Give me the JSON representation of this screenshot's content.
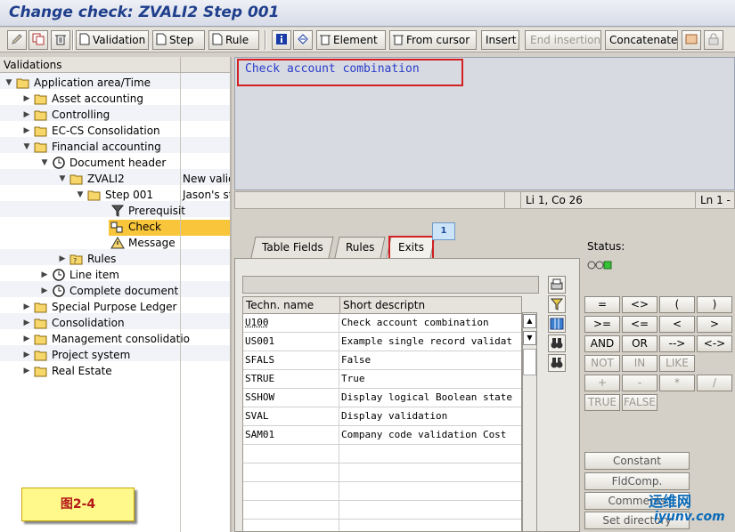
{
  "window": {
    "title": "Change check: ZVALI2 Step 001"
  },
  "toolbar": {
    "validation": "Validation",
    "step": "Step",
    "rule": "Rule",
    "element": "Element",
    "from_cursor": "From cursor",
    "insert": "Insert",
    "end_insertion": "End insertion",
    "concatenate": "Concatenate"
  },
  "tree": {
    "header": "Validations",
    "nodes": {
      "app_area": "Application area/Time",
      "asset": "Asset accounting",
      "controlling": "Controlling",
      "eccs": "EC-CS Consolidation",
      "fin": "Financial accounting",
      "doc_header": "Document header",
      "zvali2": "ZVALI2",
      "zvali2_desc": "New valid",
      "step001": "Step 001",
      "step001_desc": "Jason's st",
      "prereq": "Prerequisit",
      "check": "Check",
      "message": "Message",
      "rules": "Rules",
      "line_item": "Line item",
      "complete_doc": "Complete document",
      "special_ledger": "Special Purpose Ledger",
      "consolidation": "Consolidation",
      "mgmt_consol": "Management consolidatio",
      "project": "Project system",
      "real_estate": "Real Estate"
    }
  },
  "figure_label": "图2-4",
  "editor": {
    "text": "Check account combination",
    "cursor_pos": "Li 1, Co 26",
    "line_range": "Ln 1 -"
  },
  "tabs": {
    "table_fields": "Table Fields",
    "rules": "Rules",
    "exits": "Exits",
    "callout_number": "1"
  },
  "exits_table": {
    "headers": [
      "Techn. name",
      "Short descriptn"
    ],
    "rows": [
      [
        "U100",
        "Check account combination"
      ],
      [
        "US001",
        "Example single record validat"
      ],
      [
        "SFALS",
        "False"
      ],
      [
        "STRUE",
        "True"
      ],
      [
        "SSHOW",
        "Display logical Boolean state"
      ],
      [
        "SVAL",
        "Display validation"
      ],
      [
        "SAM01",
        "Company code validation  Cost"
      ]
    ]
  },
  "status": {
    "label": "Status:"
  },
  "operators": {
    "eq": "=",
    "ne": "<>",
    "lp": "(",
    "rp": ")",
    "ge": ">=",
    "le": "<=",
    "lt": "<",
    "gt": ">",
    "and": "AND",
    "or": "OR",
    "impl": "-->",
    "equiv": "<->",
    "not": "NOT",
    "in": "IN",
    "like": "LIKE",
    "plus": "+",
    "minus": "-",
    "mul": "*",
    "div": "/",
    "true": "TRUE",
    "false": "FALSE"
  },
  "buttons": {
    "constant": "Constant",
    "fldcomp": "FldComp.",
    "comments": "Comments",
    "set_directory": "Set directory"
  },
  "watermark": {
    "line1": "运维网",
    "line2": "iyunv.com"
  },
  "colors": {
    "selection": "#f9c53a",
    "editor_text": "#2a3cc8",
    "highlight_box": "#d22020",
    "title": "#1f3f8c"
  }
}
